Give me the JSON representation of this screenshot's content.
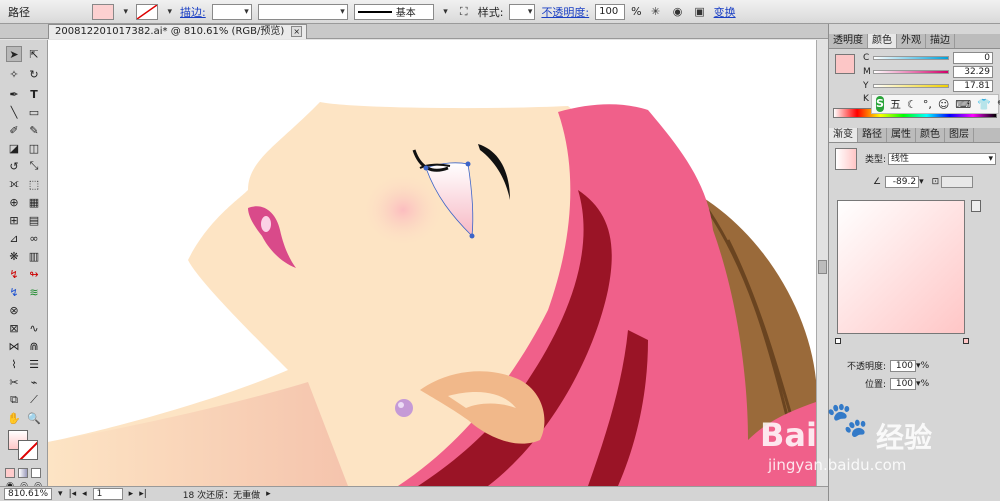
{
  "control_bar": {
    "selection_type": "路径",
    "stroke_link": "描边:",
    "stroke_style": "基本",
    "style_label": "样式:",
    "opacity_link": "不透明度:",
    "opacity_value": "100",
    "opacity_unit": "%",
    "transform_link": "变换"
  },
  "document_tab": {
    "title": "200812201017382.ai* @ 810.61% (RGB/预览)",
    "close": "×"
  },
  "color_panel": {
    "tabs": [
      "透明度",
      "颜色",
      "外观",
      "描边"
    ],
    "channels": [
      {
        "label": "C",
        "value": "0"
      },
      {
        "label": "M",
        "value": "32.29"
      },
      {
        "label": "Y",
        "value": "17.81"
      },
      {
        "label": "K",
        "value": ""
      }
    ]
  },
  "ime_toolbar": {
    "mode": "五"
  },
  "gradient_panel": {
    "tabs": [
      "渐变",
      "路径",
      "属性",
      "颜色",
      "图层"
    ],
    "type_label": "类型:",
    "type_value": "线性",
    "angle_value": "-89.2",
    "opacity_label": "不透明度:",
    "opacity_value": "100",
    "location_label": "位置:",
    "location_value": "100",
    "percent": "%"
  },
  "status_bar": {
    "zoom": "810.61%",
    "artboard": "1",
    "undo_status": "18 次还原：无重做"
  },
  "watermark": {
    "brand": "Bai",
    "brand_cn": "经验",
    "url": "jingyan.baidu.com"
  },
  "colors": {
    "skin": "#fde4c4",
    "headband": "#f0608a",
    "headband_dark": "#9a1426",
    "hair": "#9a6a3a",
    "gradient_start": "#ffffff",
    "gradient_end": "#ffc6c6"
  }
}
